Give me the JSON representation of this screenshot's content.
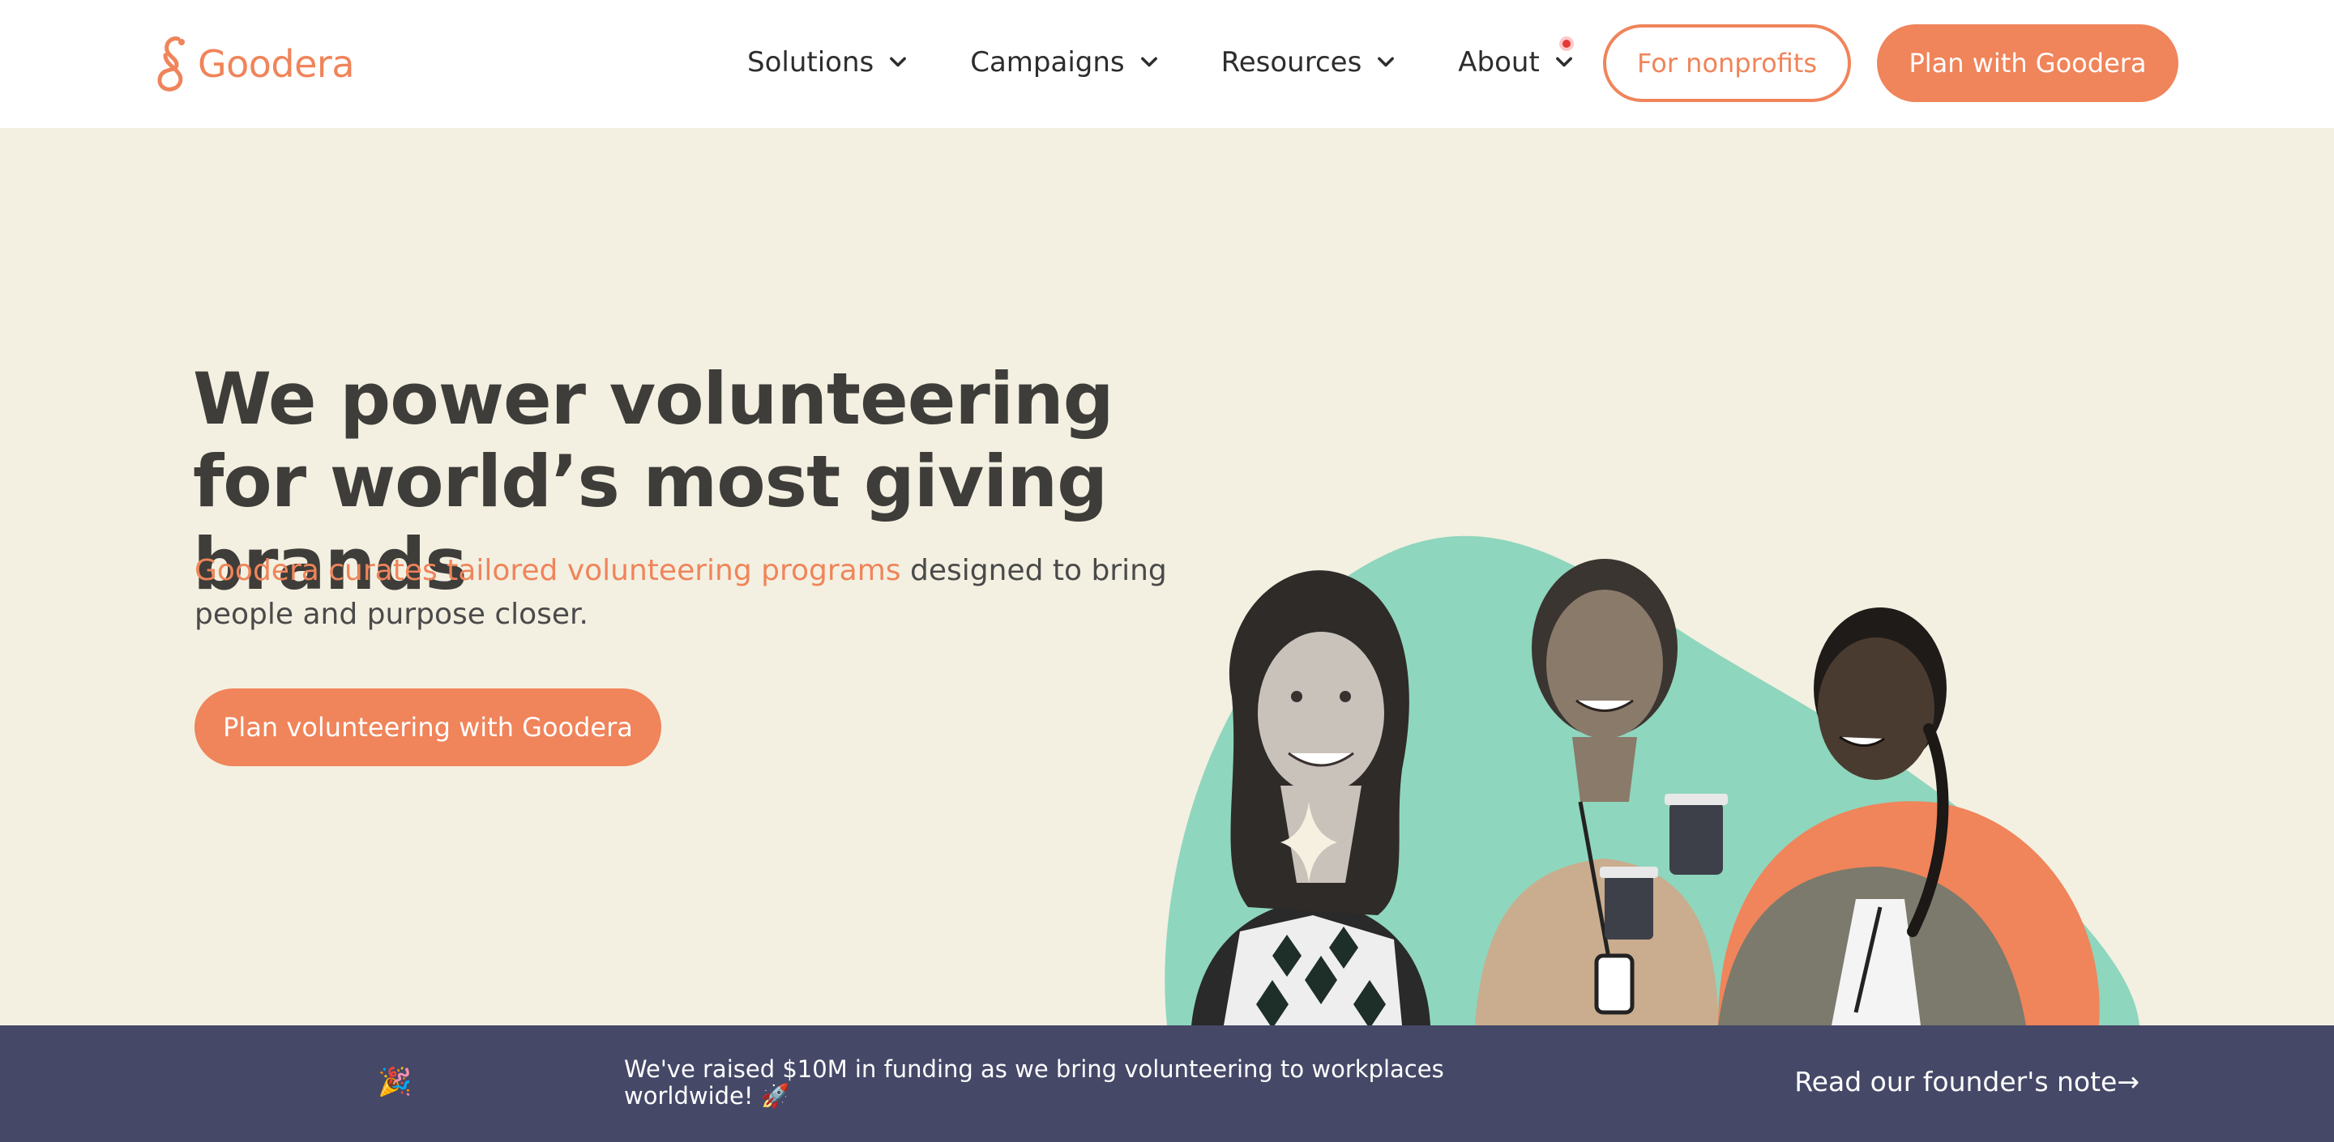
{
  "brand": {
    "name": "Goodera",
    "accent": "#f0845a",
    "logo_icon": "goodera-logo-icon"
  },
  "nav": {
    "items": [
      {
        "label": "Solutions",
        "icon": "chevron-down-icon"
      },
      {
        "label": "Campaigns",
        "icon": "chevron-down-icon"
      },
      {
        "label": "Resources",
        "icon": "chevron-down-icon"
      },
      {
        "label": "About",
        "icon": "chevron-down-icon"
      }
    ]
  },
  "header_buttons": {
    "nonprofits": "For nonprofits",
    "plan": "Plan with Goodera"
  },
  "hero": {
    "title": "We power volunteering for world’s most giving brands",
    "subtitle_highlight": "Goodera curates tailored volunteering programs",
    "subtitle_rest": " designed to bring people and purpose closer.",
    "cta": "Plan volunteering with Goodera",
    "background": "#f3f0e1",
    "art_colors": {
      "teal": "#8fd6be",
      "orange": "#f0845a"
    }
  },
  "banner": {
    "emoji_left": "🎉",
    "text": "We've raised $10M in funding as we bring volunteering to workplaces worldwide! 🚀",
    "link": "Read our founder's note→",
    "background": "#454867"
  }
}
